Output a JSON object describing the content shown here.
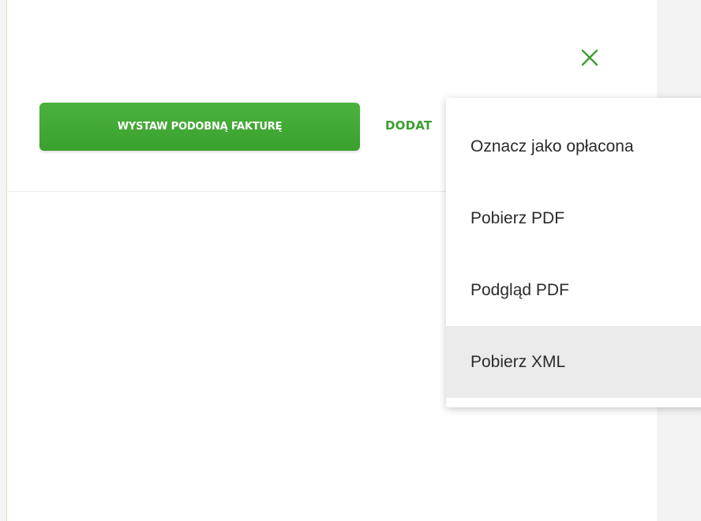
{
  "header": {
    "close_icon": "close-icon",
    "close_color": "#3aa02e"
  },
  "actions": {
    "primary_label": "WYSTAW PODOBNĄ FAKTURĘ",
    "more_label": "DODAT",
    "accent_color": "#3aa02e"
  },
  "menu": {
    "items": [
      {
        "label": "Oznacz jako opłacona"
      },
      {
        "label": "Pobierz PDF"
      },
      {
        "label": "Podgląd PDF"
      },
      {
        "label": "Pobierz XML"
      }
    ],
    "highlighted_item": "Pobierz XML"
  }
}
